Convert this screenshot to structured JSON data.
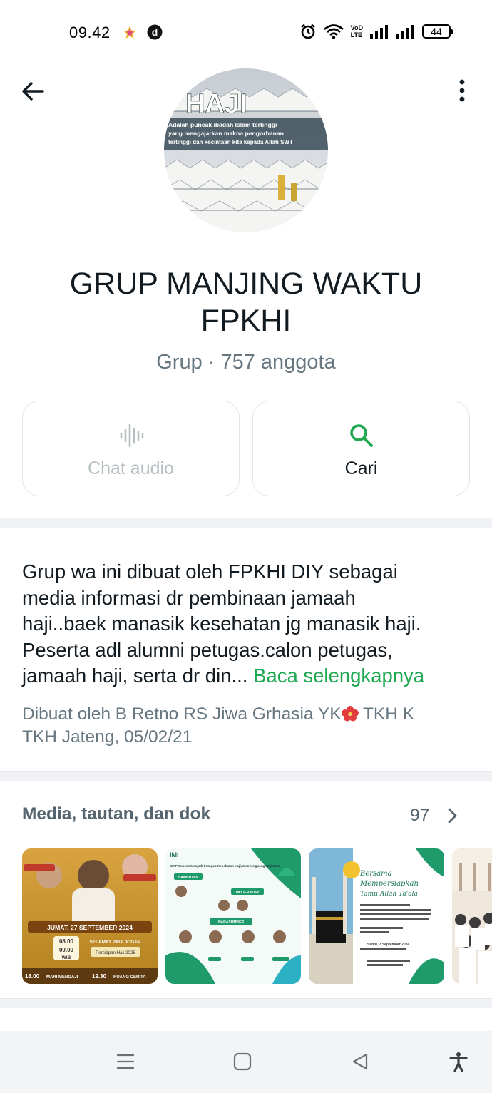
{
  "status_bar": {
    "time": "09.42",
    "battery": "44",
    "network_label_top": "VoD",
    "network_label_bottom": "LTE"
  },
  "group": {
    "name": "GRUP MANJING WAKTU FPKHI",
    "subtitle": "Grup · 757 anggota"
  },
  "avatar": {
    "heading": "HAJI",
    "line1": "Adalah puncak ibadah Islam tertinggi",
    "line2": "yang mengajarkan makna pengorbanan",
    "line3": "tertinggi dan kecintaan kita kepada Allah SWT"
  },
  "actions": {
    "audio_label": "Chat audio",
    "search_label": "Cari"
  },
  "description": {
    "line1": "Grup wa ini dibuat oleh FPKHI DIY  sebagai",
    "line2": "media informasi dr pembinaan jamaah",
    "line3": "haji..baek manasik kesehatan jg manasik haji.",
    "line4": "Peserta adl alumni petugas.calon petugas,",
    "line5": "jamaah haji,  serta dr din...",
    "read_more": "Baca selengkapnya",
    "created_line1": "Dibuat oleh B Retno RS Jiwa Grhasia YK",
    "created_line1_end": " TKH K",
    "created_line2": "TKH Jateng, 05/02/21"
  },
  "media": {
    "title": "Media, tautan, dan dok",
    "count": "97",
    "thumbnails": [
      {
        "date": "JUMAT, 27 SEPTEMBER 2024",
        "time1": "08.00",
        "time2": "09.00",
        "wib": "WIB",
        "greeting": "SELAMAT PAGI JOGJA",
        "topic": "Persiapan Haji 2025",
        "t1": "18.00",
        "t2": "19.30",
        "seg1": "MARI MENGAJI",
        "seg2": "RUANG CERITA"
      },
      {
        "brand": "IMI",
        "title": "SIAP Sukses Menjadi Petugas Kesehatan Haji, Menyongsong Haji 2025",
        "tag1": "SAMBUTAN",
        "tag2": "MODERATOR",
        "tag3": "NARASUMBER"
      },
      {
        "heading1": "Bersama",
        "heading2": "Mempersiapkan",
        "heading3": "Tamu Allah Ta'ala",
        "date": "Sabtu, 7 September 2024"
      },
      {}
    ]
  },
  "colors": {
    "accent_green": "#1da851",
    "text_primary": "#111b21",
    "text_secondary": "#667781",
    "divider": "#f0f2f5"
  }
}
